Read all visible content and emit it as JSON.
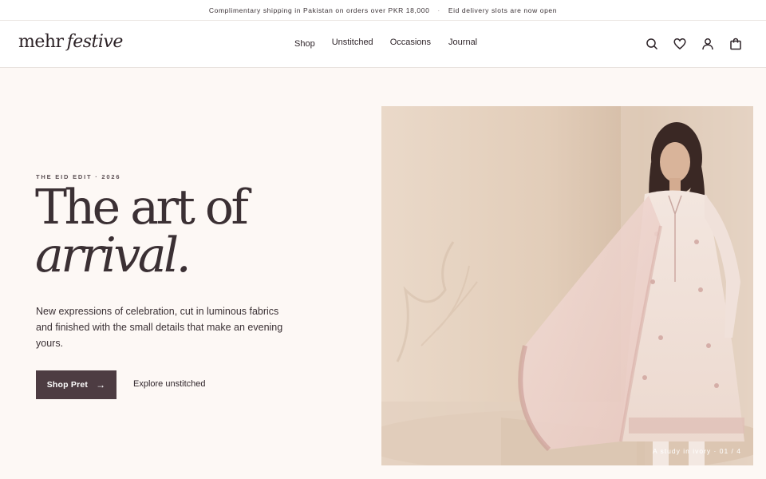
{
  "announcement": {
    "shipping": "Complimentary shipping in Pakistan on orders over PKR 18,000",
    "separator": "·",
    "eid": "Eid delivery slots are now open"
  },
  "header": {
    "logo_main": "mehr",
    "logo_italic": "festive",
    "nav": [
      "Shop",
      "Unstitched",
      "Occasions",
      "Journal"
    ],
    "icons": [
      "search-icon",
      "heart-icon",
      "user-icon",
      "bag-icon"
    ]
  },
  "hero": {
    "eyebrow": "THE EID EDIT · 2026",
    "headline_line1": "The art of",
    "headline_line2": "arrival.",
    "subcopy": "New expressions of celebration, cut in luminous fabrics and finished with the small details that make an evening yours.",
    "cta_primary": "Shop Pret",
    "cta_arrow": "→",
    "cta_secondary": "Explore unstitched",
    "image_caption": "A study in ivory · 01 / 4"
  },
  "colors": {
    "background": "#fdf8f5",
    "button": "#4d3c42",
    "text": "#2e2429"
  }
}
